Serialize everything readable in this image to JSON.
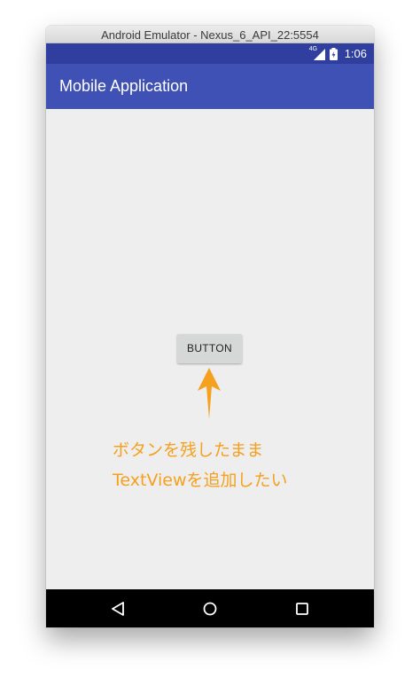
{
  "window": {
    "title": "Android Emulator - Nexus_6_API_22:5554"
  },
  "status_bar": {
    "network_label": "4G",
    "time": "1:06",
    "icons": [
      "signal-icon",
      "battery-icon"
    ],
    "background_color": "#303f9f"
  },
  "app_bar": {
    "title": "Mobile Application",
    "background_color": "#3f51b5"
  },
  "main": {
    "button_label": "BUTTON"
  },
  "annotation": {
    "line1": "ボタンを残したまま",
    "line2": "TextViewを追加したい",
    "color": "#f5a01e"
  },
  "nav_bar": {
    "icons": [
      "back-icon",
      "home-icon",
      "recents-icon"
    ]
  }
}
